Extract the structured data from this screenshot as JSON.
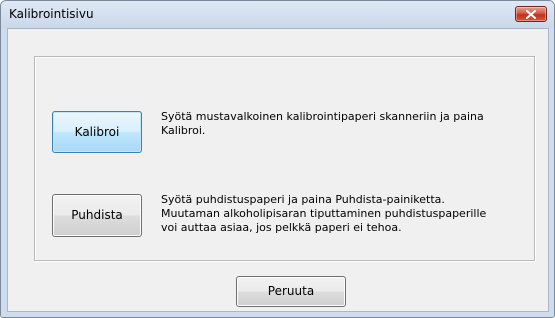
{
  "window": {
    "title": "Kalibrointisivu"
  },
  "calibrate": {
    "button_label": "Kalibroi",
    "description": "Syötä mustavalkoinen kalibrointipaperi skanneriin ja paina\nKalibroi."
  },
  "clean": {
    "button_label": "Puhdista",
    "description": "Syötä puhdistuspaperi ja paina Puhdista-painiketta.\nMuutaman alkoholipisaran tiputtaminen puhdistuspaperille\nvoi auttaa asiaa, jos pelkkä paperi ei tehoa."
  },
  "footer": {
    "cancel_label": "Peruuta"
  },
  "icons": {
    "close": "close-icon"
  },
  "colors": {
    "close_button": "#c2321d",
    "focus_border": "#3c7fb1",
    "dialog_background": "#f0f0f0"
  }
}
